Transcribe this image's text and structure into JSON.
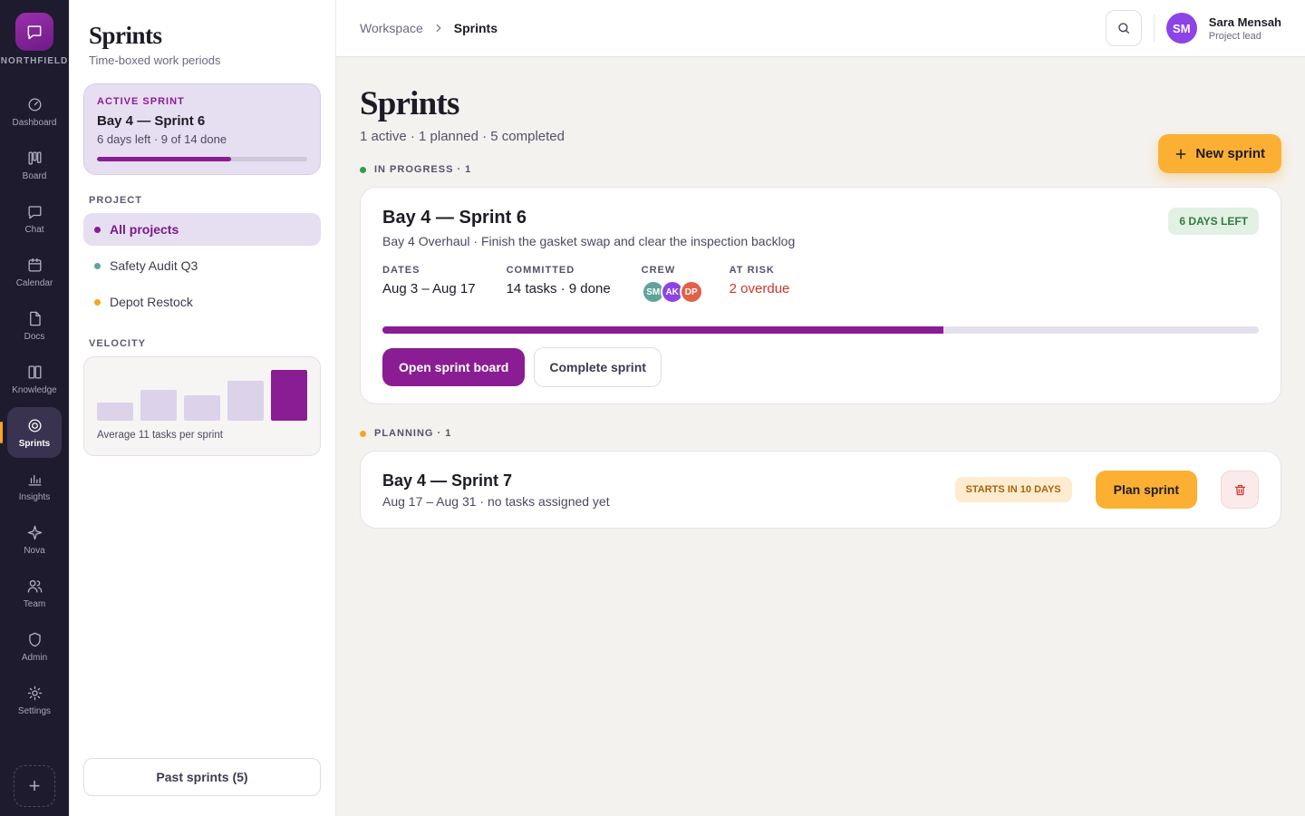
{
  "brand": {
    "name": "NORTHFIELD"
  },
  "rail": {
    "items": [
      {
        "label": "Dashboard",
        "icon": "dashboard-icon"
      },
      {
        "label": "Board",
        "icon": "board-icon"
      },
      {
        "label": "Chat",
        "icon": "chat-icon"
      },
      {
        "label": "Calendar",
        "icon": "calendar-icon"
      },
      {
        "label": "Docs",
        "icon": "docs-icon"
      },
      {
        "label": "Knowledge",
        "icon": "knowledge-icon"
      },
      {
        "label": "Sprints",
        "icon": "sprints-icon",
        "active": true
      },
      {
        "label": "Insights",
        "icon": "insights-icon"
      },
      {
        "label": "Nova",
        "icon": "nova-icon"
      },
      {
        "label": "Team",
        "icon": "team-icon"
      },
      {
        "label": "Admin",
        "icon": "admin-icon"
      },
      {
        "label": "Settings",
        "icon": "settings-icon"
      }
    ],
    "add_label": "+"
  },
  "sidebar": {
    "title": "Sprints",
    "subtitle": "Time-boxed work periods",
    "active_sprint": {
      "label": "ACTIVE SPRINT",
      "name": "Bay 4 — Sprint 6",
      "meta": "6 days left · 9 of 14 done",
      "progress": 0.64
    },
    "project_heading": "PROJECT",
    "projects": [
      {
        "label": "All projects",
        "color": "#8a1d93",
        "active": true
      },
      {
        "label": "Safety Audit Q3",
        "color": "#5fa39a"
      },
      {
        "label": "Depot Restock",
        "color": "#f5a623"
      }
    ],
    "velocity_heading": "VELOCITY",
    "velocity": {
      "bars": [
        0.36,
        0.61,
        0.5,
        0.79,
        1.0
      ],
      "caption": "Average 11 tasks per sprint"
    },
    "past_button": "Past sprints (5)"
  },
  "topbar": {
    "breadcrumb": [
      "Workspace",
      "Sprints"
    ],
    "user": {
      "initials": "SM",
      "name": "Sara Mensah",
      "role": "Project lead"
    }
  },
  "main": {
    "title": "Sprints",
    "subtitle": "1 active · 1 planned · 5 completed",
    "new_button": "New sprint",
    "in_progress": {
      "heading": "IN PROGRESS · 1",
      "color": "#2f9e4f",
      "sprint": {
        "name": "Bay 4 — Sprint 6",
        "description": "Bay 4 Overhaul · Finish the gasket swap and clear the inspection backlog",
        "badge": "6 DAYS LEFT",
        "dates_label": "DATES",
        "dates": "Aug 3 – Aug 17",
        "committed_label": "COMMITTED",
        "committed": "14 tasks · 9 done",
        "crew_label": "CREW",
        "crew": [
          {
            "initials": "SM",
            "color": "#5fa39a"
          },
          {
            "initials": "AK",
            "color": "#8d44e6"
          },
          {
            "initials": "DP",
            "color": "#e0604a"
          }
        ],
        "risk_label": "AT RISK",
        "risk": "2 overdue",
        "progress": 0.64,
        "open_button": "Open sprint board",
        "complete_button": "Complete sprint"
      }
    },
    "planning": {
      "heading": "PLANNING · 1",
      "color": "#f5a623",
      "sprint": {
        "name": "Bay 4 — Sprint 7",
        "meta": "Aug 17 – Aug 31 · no tasks assigned yet",
        "badge": "STARTS IN 10 DAYS",
        "plan_button": "Plan sprint"
      }
    }
  }
}
